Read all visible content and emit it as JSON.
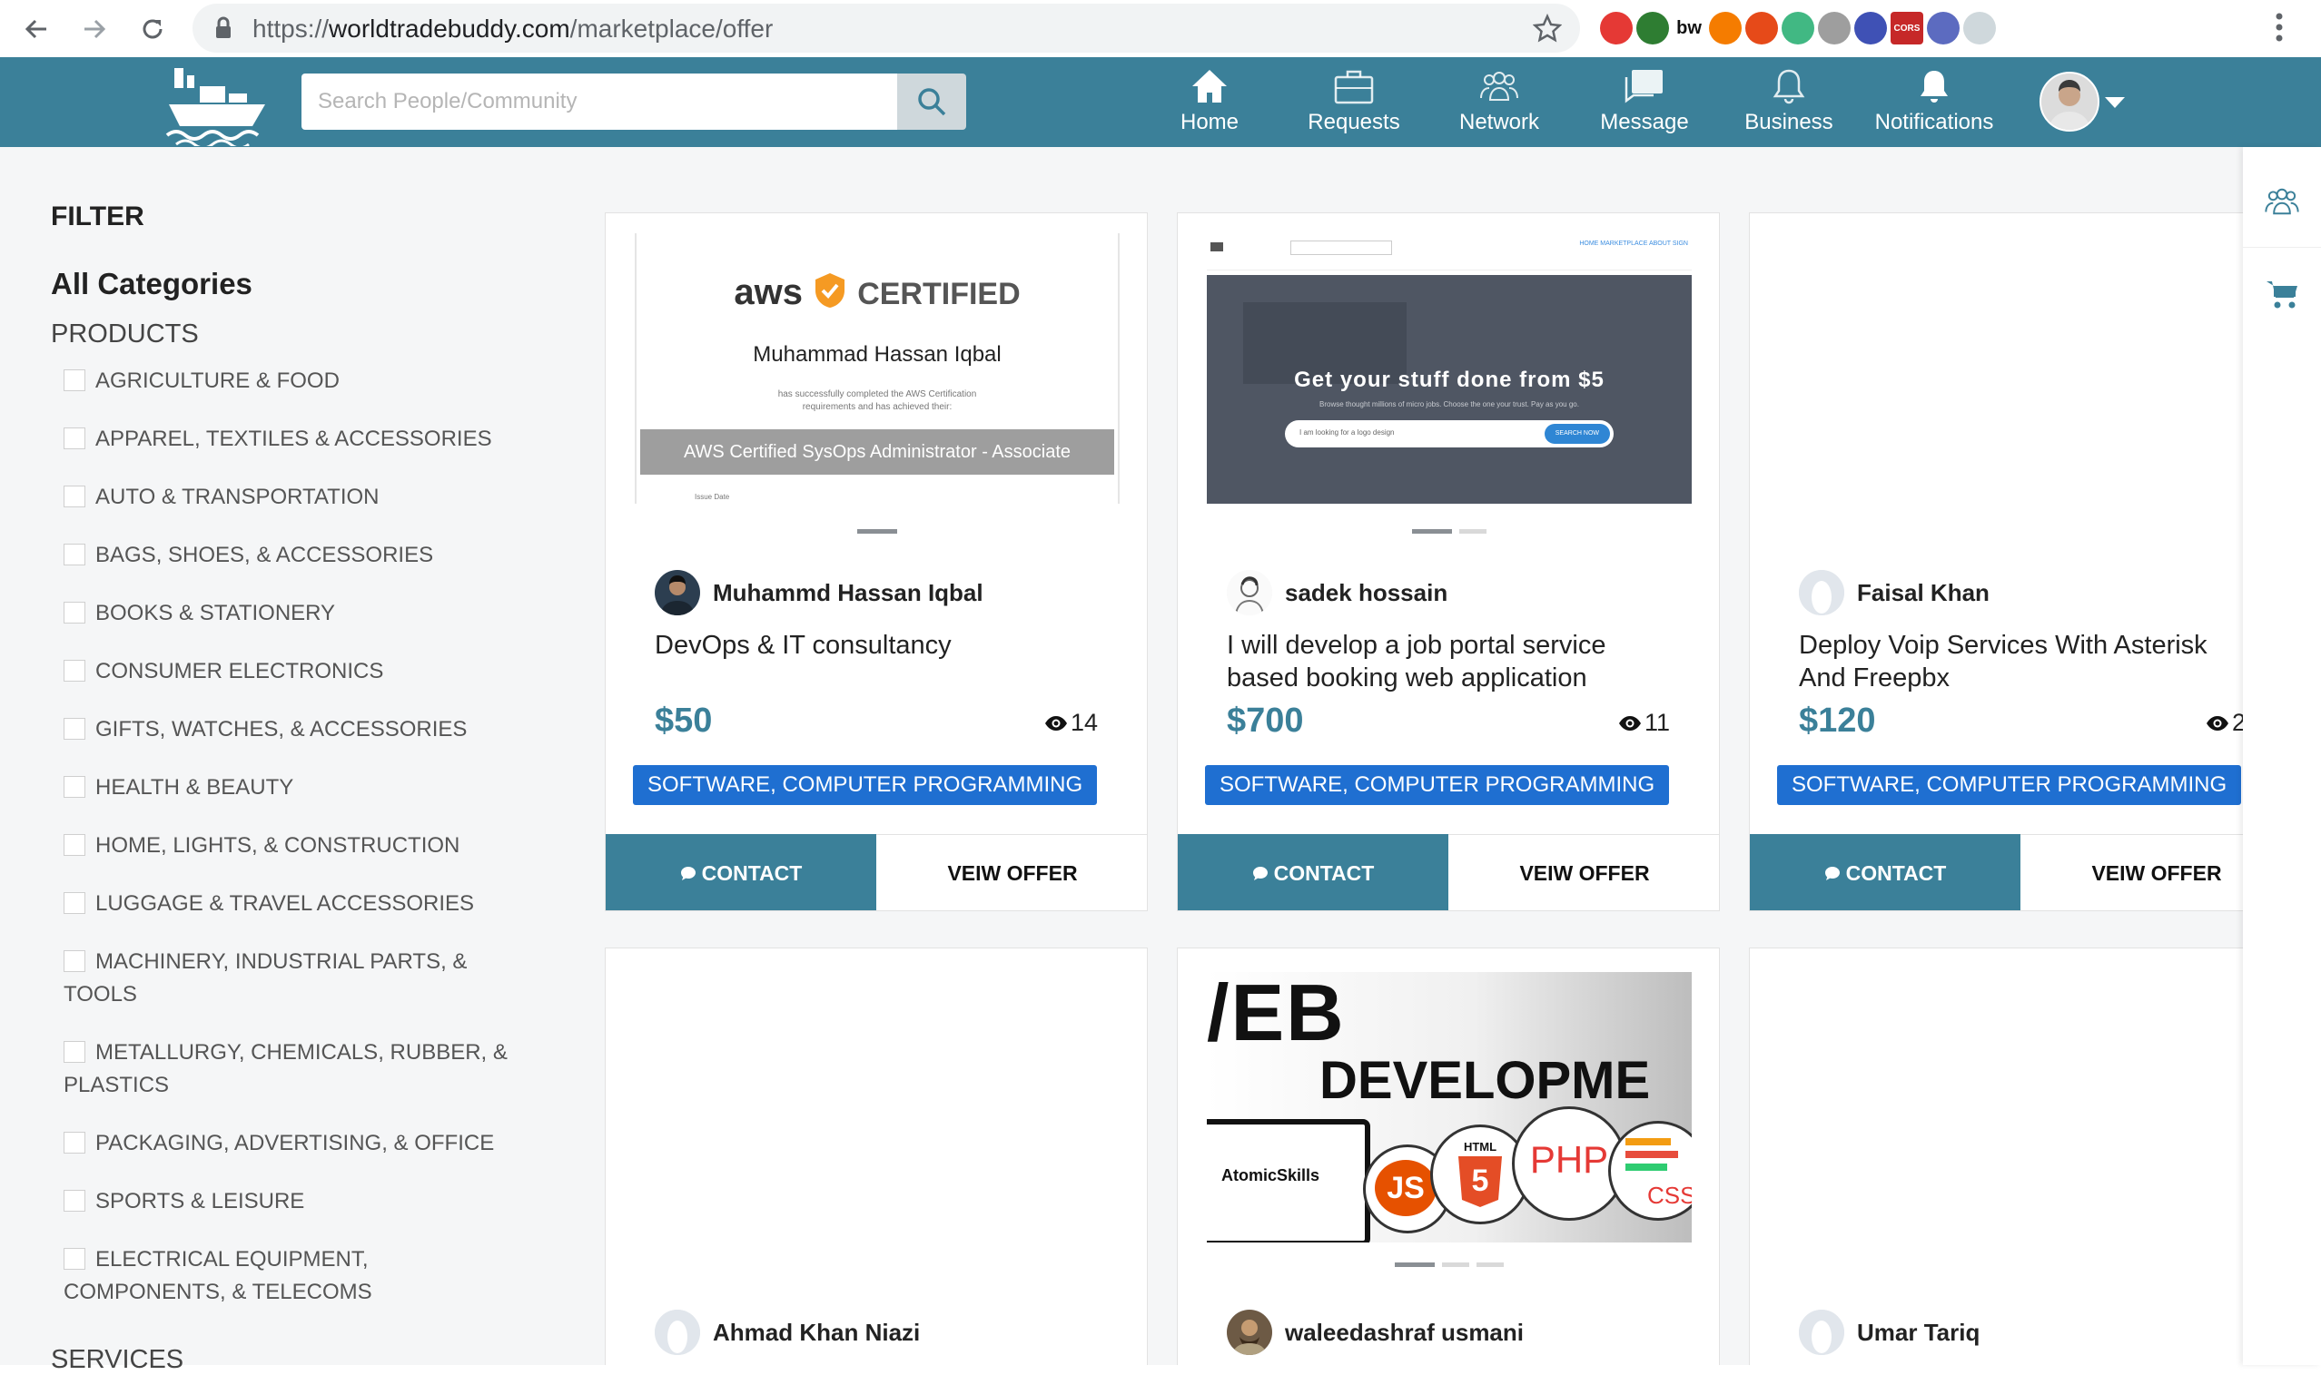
{
  "browser": {
    "url_scheme": "https://",
    "url_host": "worldtradebuddy.com",
    "url_path": "/marketplace/offer",
    "extensions": [
      {
        "name": "ublock-icon",
        "color": "#e53935",
        "label": ""
      },
      {
        "name": "mountain-icon",
        "color": "#2e7d32",
        "label": ""
      },
      {
        "name": "bw-icon",
        "color": "#ffffff",
        "label": "bw"
      },
      {
        "name": "rss-icon",
        "color": "#f57c00",
        "label": ""
      },
      {
        "name": "lifebuoy-icon",
        "color": "#e64a19",
        "label": ""
      },
      {
        "name": "vue-icon",
        "color": "#41b883",
        "label": ""
      },
      {
        "name": "globe-icon",
        "color": "#9e9e9e",
        "label": ""
      },
      {
        "name": "opera-icon",
        "color": "#3f51b5",
        "label": ""
      },
      {
        "name": "cors-icon",
        "color": "#c62828",
        "label": "CORS"
      },
      {
        "name": "link-icon",
        "color": "#5c6bc0",
        "label": ""
      },
      {
        "name": "profile-icon",
        "color": "#cfd8dc",
        "label": ""
      }
    ]
  },
  "colors": {
    "brand": "#3b8099",
    "tag": "#1f6fd1",
    "background": "#f5f6f7"
  },
  "header": {
    "search_placeholder": "Search People/Community",
    "nav": [
      {
        "label": "Home",
        "icon": "home-icon"
      },
      {
        "label": "Requests",
        "icon": "briefcase-icon"
      },
      {
        "label": "Network",
        "icon": "people-icon"
      },
      {
        "label": "Message",
        "icon": "message-icon"
      },
      {
        "label": "Business",
        "icon": "bell-outline-icon"
      },
      {
        "label": "Notifications",
        "icon": "bell-icon"
      }
    ]
  },
  "filter": {
    "title": "FILTER",
    "categories_title": "All Categories",
    "products_title": "PRODUCTS",
    "products": [
      "AGRICULTURE & FOOD",
      "APPAREL, TEXTILES & ACCESSORIES",
      "AUTO & TRANSPORTATION",
      "BAGS, SHOES, & ACCESSORIES",
      "BOOKS & STATIONERY",
      "CONSUMER ELECTRONICS",
      "GIFTS, WATCHES, & ACCESSORIES",
      "HEALTH & BEAUTY",
      "HOME, LIGHTS, & CONSTRUCTION",
      "LUGGAGE & TRAVEL ACCESSORIES",
      "MACHINERY, INDUSTRIAL PARTS, & TOOLS",
      "METALLURGY, CHEMICALS, RUBBER, & PLASTICS",
      "PACKAGING, ADVERTISING, & OFFICE",
      "SPORTS & LEISURE",
      "ELECTRICAL EQUIPMENT, COMPONENTS, & TELECOMS"
    ],
    "services_title": "SERVICES"
  },
  "cards": [
    {
      "seller": "Muhammd Hassan Iqbal",
      "title": "DevOps & IT consultancy",
      "price": "$50",
      "views": "14",
      "tag": "SOFTWARE, COMPUTER PROGRAMMING",
      "contact": "CONTACT",
      "view_offer": "VEIW OFFER",
      "image": {
        "brand": "aws",
        "heading": "CERTIFIED",
        "name": "Muhammad Hassan Iqbal",
        "line1": "has successfully completed the AWS Certification",
        "line2": "requirements and has achieved their:",
        "bar": "AWS Certified SysOps Administrator - Associate",
        "footer": "Issue Date"
      }
    },
    {
      "seller": "sadek hossain",
      "title": "I will develop a job portal service based booking web application",
      "price": "$700",
      "views": "11",
      "tag": "SOFTWARE, COMPUTER PROGRAMMING",
      "contact": "CONTACT",
      "view_offer": "VEIW OFFER",
      "image": {
        "heading": "Get your stuff done from $5",
        "sub": "Browse thought millions of micro jobs. Choose the one your trust. Pay as you go.",
        "input": "I am looking for a logo design",
        "button": "SEARCH NOW",
        "nav": "HOME   MARKETPLACE   ABOUT   SIGN"
      }
    },
    {
      "seller": "Faisal Khan",
      "title": "Deploy Voip Services With Asterisk And Freepbx",
      "price": "$120",
      "views": "2",
      "tag": "SOFTWARE, COMPUTER PROGRAMMING",
      "contact": "CONTACT",
      "view_offer": "VEIW OFFER"
    },
    {
      "seller": "Ahmad Khan Niazi"
    },
    {
      "seller": "waleedashraf usmani",
      "image": {
        "line1": "/EB",
        "line2": "DEVELOPME",
        "brand": "AtomicSkills",
        "js": "JS",
        "html": "HTML",
        "five": "5",
        "php": "PHP",
        "css": "CSS"
      }
    },
    {
      "seller": "Umar Tariq"
    }
  ]
}
